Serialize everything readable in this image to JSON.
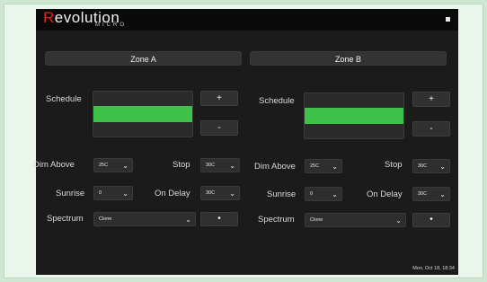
{
  "app": {
    "logo_main": "Revolution",
    "logo_first_letter": "R",
    "logo_rest": "evolution",
    "logo_sub": "MICRO"
  },
  "zones": [
    {
      "name": "Zone A",
      "schedule_label": "Schedule",
      "plus_label": "+",
      "minus_label": "-",
      "dim_above_label": "Dim Above",
      "dim_above_value": "25C",
      "stop_label": "Stop",
      "stop_value": "30C",
      "sunrise_label": "Sunrise",
      "sunrise_value": "0",
      "on_delay_label": "On Delay",
      "on_delay_value": "30C",
      "spectrum_label": "Spectrum",
      "spectrum_value": "Clone",
      "spectrum_button_label": "•"
    },
    {
      "name": "Zone B",
      "schedule_label": "Schedule",
      "plus_label": "+",
      "minus_label": "-",
      "dim_above_label": "Dim Above",
      "dim_above_value": "25C",
      "stop_label": "Stop",
      "stop_value": "30C",
      "sunrise_label": "Sunrise",
      "sunrise_value": "0",
      "on_delay_label": "On Delay",
      "on_delay_value": "30C",
      "spectrum_label": "Spectrum",
      "spectrum_value": "Clone",
      "spectrum_button_label": "•"
    }
  ],
  "status": {
    "datetime": "Mon, Oct 18, 18:34"
  },
  "colors": {
    "schedule_fill": "#3fc24a",
    "logo_accent": "#e0241b"
  },
  "icons": {
    "menu": "menu-icon",
    "dropdown": "chevron-down-icon"
  }
}
